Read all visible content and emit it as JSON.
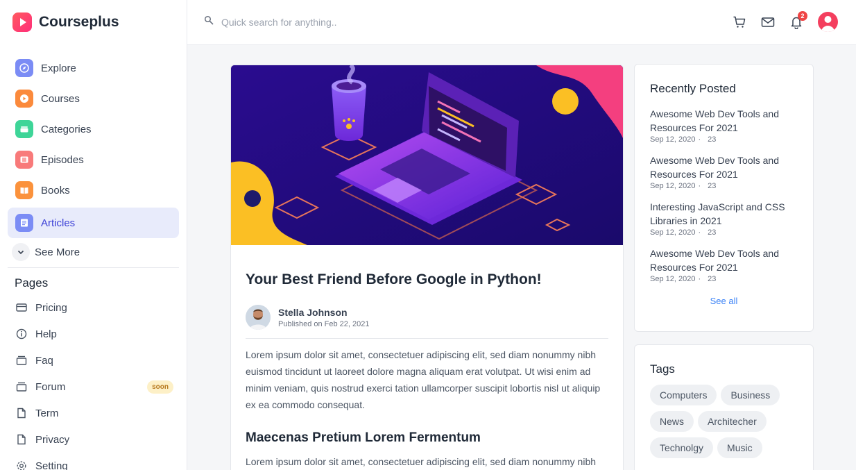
{
  "app": {
    "name": "Courseplus"
  },
  "sidebar": {
    "nav": [
      {
        "label": "Explore",
        "icon": "compass-icon",
        "color": "#6b7ff2"
      },
      {
        "label": "Courses",
        "icon": "play-icon",
        "color": "#f97316"
      },
      {
        "label": "Categories",
        "icon": "folder-icon",
        "color": "#34d399"
      },
      {
        "label": "Episodes",
        "icon": "film-icon",
        "color": "#f87171"
      },
      {
        "label": "Books",
        "icon": "book-icon",
        "color": "#fb923c"
      },
      {
        "label": "Articles",
        "icon": "article-icon",
        "color": "#6b7ff2",
        "active": true
      }
    ],
    "see_more": "See More",
    "pages_title": "Pages",
    "pages": [
      {
        "label": "Pricing",
        "icon": "card-icon"
      },
      {
        "label": "Help",
        "icon": "info-icon"
      },
      {
        "label": "Faq",
        "icon": "inbox-icon"
      },
      {
        "label": "Forum",
        "icon": "forum-icon",
        "badge": "soon"
      },
      {
        "label": "Term",
        "icon": "file-icon"
      },
      {
        "label": "Privacy",
        "icon": "file-icon"
      },
      {
        "label": "Setting",
        "icon": "gear-icon"
      }
    ]
  },
  "header": {
    "search_placeholder": "Quick search for anything..",
    "notification_count": "2"
  },
  "article": {
    "title": "Your Best Friend Before Google in Python!",
    "author": "Stella Johnson",
    "published": "Published on Feb 22, 2021",
    "paragraph1": "Lorem ipsum dolor sit amet, consectetuer adipiscing elit, sed diam nonummy nibh euismod tincidunt ut laoreet dolore magna aliquam erat volutpat. Ut wisi enim ad minim veniam, quis nostrud exerci tation ullamcorper suscipit lobortis nisl ut aliquip ex ea commodo consequat.",
    "subheading": "Maecenas Pretium Lorem Fermentum",
    "paragraph2": "Lorem ipsum dolor sit amet, consectetuer adipiscing elit, sed diam nonummy nibh euismod tincidunt ut laoreet dolore magna aliquam erat volutpat."
  },
  "recent": {
    "title": "Recently Posted",
    "posts": [
      {
        "title": "Awesome Web Dev Tools and Resources For 2021",
        "date": "Sep 12, 2020",
        "dot": "·",
        "count": "23"
      },
      {
        "title": "Awesome Web Dev Tools and Resources For 2021",
        "date": "Sep 12, 2020",
        "dot": "·",
        "count": "23"
      },
      {
        "title": "Interesting JavaScript and CSS Libraries in 2021",
        "date": "Sep 12, 2020",
        "dot": "·",
        "count": "23"
      },
      {
        "title": "Awesome Web Dev Tools and Resources For 2021",
        "date": "Sep 12, 2020",
        "dot": "·",
        "count": "23"
      }
    ],
    "see_all": "See all"
  },
  "tags": {
    "title": "Tags",
    "items": [
      "Computers",
      "Business",
      "News",
      "Architecher",
      "Technolgy",
      "Music"
    ]
  }
}
